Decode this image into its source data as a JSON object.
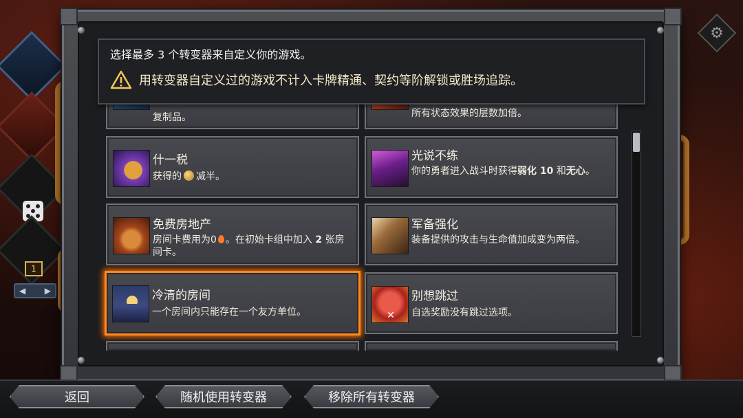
{
  "header": {
    "title": "选择最多 3 个转变器来自定义你的游戏。",
    "warning": "用转变器自定义过的游戏不计入卡牌精通、契约等阶解锁或胜场追踪。"
  },
  "modifiers": [
    {
      "title": "",
      "desc": "复制品。"
    },
    {
      "title": "",
      "desc": "所有状态效果的层数加倍。"
    },
    {
      "title": "什一税",
      "desc_before": "获得的",
      "desc_after": "减半。"
    },
    {
      "title": "光说不练",
      "desc_before": "你的勇者进入战斗时获得",
      "bold1": "弱化 10",
      "desc_mid": "和",
      "bold2": "无心",
      "desc_after": "。"
    },
    {
      "title": "免费房地产",
      "desc_before": "房间卡费用为0",
      "desc_mid": "。在初始卡组中加入",
      "bold1": "2",
      "desc_after": "张房间卡。"
    },
    {
      "title": "军备强化",
      "desc": "装备提供的攻击与生命值加成变为两倍。"
    },
    {
      "title": "冷清的房间",
      "desc": "一个房间内只能存在一个友方单位。",
      "selected": true
    },
    {
      "title": "别想跳过",
      "desc": "自选奖励没有跳过选项。"
    }
  ],
  "buttons": {
    "back": "返回",
    "randomize": "随机使用转变器",
    "remove_all": "移除所有转变器"
  },
  "left_panel": {
    "page_number": "1"
  },
  "colors": {
    "selected_glow": "#ff8a1e",
    "pipe": "#b5742b"
  }
}
